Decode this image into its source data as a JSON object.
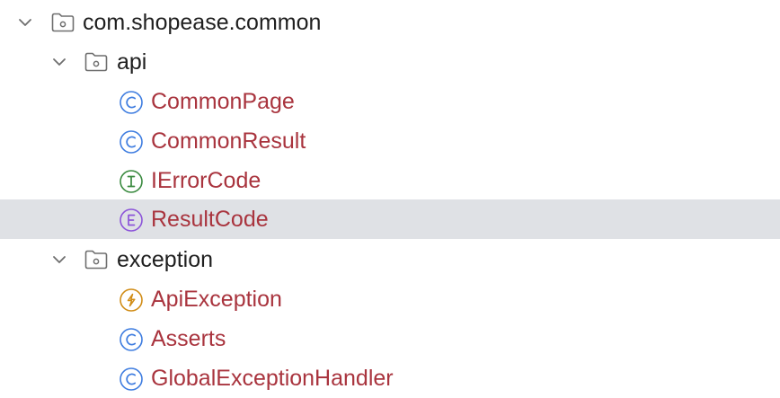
{
  "colors": {
    "selection_bg": "#dfe1e5",
    "package_text": "#1f1f1f",
    "class_text": "#a9343e",
    "class_icon": "#3f7de0",
    "interface_icon": "#3a8a3f",
    "enum_icon": "#8c55d9",
    "exception_icon": "#d18d17"
  },
  "tree": {
    "root": {
      "label": "com.shopease.common",
      "expanded": true,
      "icon": "folder-package-icon"
    },
    "api": {
      "label": "api",
      "expanded": true,
      "icon": "folder-package-icon",
      "children": [
        {
          "label": "CommonPage",
          "kind": "class",
          "glyph": "C"
        },
        {
          "label": "CommonResult",
          "kind": "class",
          "glyph": "C"
        },
        {
          "label": "IErrorCode",
          "kind": "interface",
          "glyph": "I"
        },
        {
          "label": "ResultCode",
          "kind": "enum",
          "glyph": "E",
          "selected": true
        }
      ]
    },
    "exception": {
      "label": "exception",
      "expanded": true,
      "icon": "folder-package-icon",
      "children": [
        {
          "label": "ApiException",
          "kind": "exception",
          "glyph": "⚡"
        },
        {
          "label": "Asserts",
          "kind": "class",
          "glyph": "C"
        },
        {
          "label": "GlobalExceptionHandler",
          "kind": "class",
          "glyph": "C"
        }
      ]
    }
  }
}
